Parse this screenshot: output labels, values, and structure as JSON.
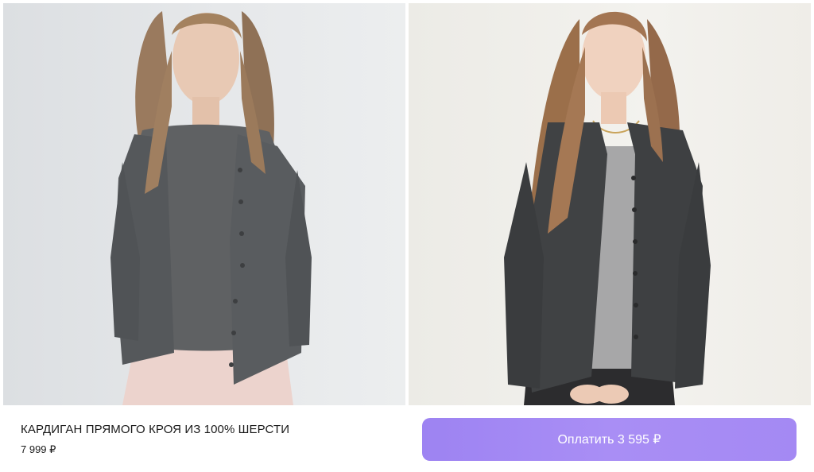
{
  "product": {
    "title": "КАРДИГАН ПРЯМОГО КРОЯ ИЗ 100% ШЕРСТИ",
    "price": "7 999 ₽"
  },
  "pay_button": {
    "label": "Оплатить 3 595 ₽",
    "color": "#a48af4"
  }
}
